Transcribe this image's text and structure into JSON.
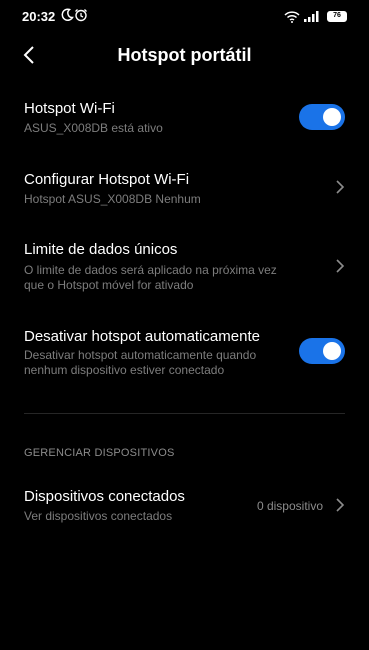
{
  "status_bar": {
    "time": "20:32",
    "battery": "76"
  },
  "header": {
    "title": "Hotspot portátil"
  },
  "settings": [
    {
      "title": "Hotspot Wi-Fi",
      "subtitle": "ASUS_X008DB está ativo",
      "toggle": true
    },
    {
      "title": "Configurar Hotspot Wi-Fi",
      "subtitle": "Hotspot ASUS_X008DB Nenhum"
    },
    {
      "title": "Limite de dados únicos",
      "subtitle_line1": "O limite de dados será aplicado na próxima vez",
      "subtitle_line2": "que o Hotspot móvel for ativado"
    },
    {
      "title": "Desativar hotspot automaticamente",
      "subtitle_line1": "Desativar hotspot automaticamente quando",
      "subtitle_line2": "nenhum dispositivo estiver conectado",
      "toggle": true
    }
  ],
  "devices_section": {
    "header": "GERENCIAR DISPOSITIVOS",
    "connected": {
      "title": "Dispositivos conectados",
      "subtitle": "Ver dispositivos conectados",
      "value": "0 dispositivo"
    }
  },
  "colors": {
    "accent": "#1a73e8",
    "background": "#000000",
    "secondary_text": "#7d7d7d"
  },
  "icons": [
    "moon-icon",
    "alarm-icon",
    "wifi-icon",
    "signal-icon",
    "battery-icon",
    "back-arrow-icon",
    "chevron-right-icon"
  ]
}
